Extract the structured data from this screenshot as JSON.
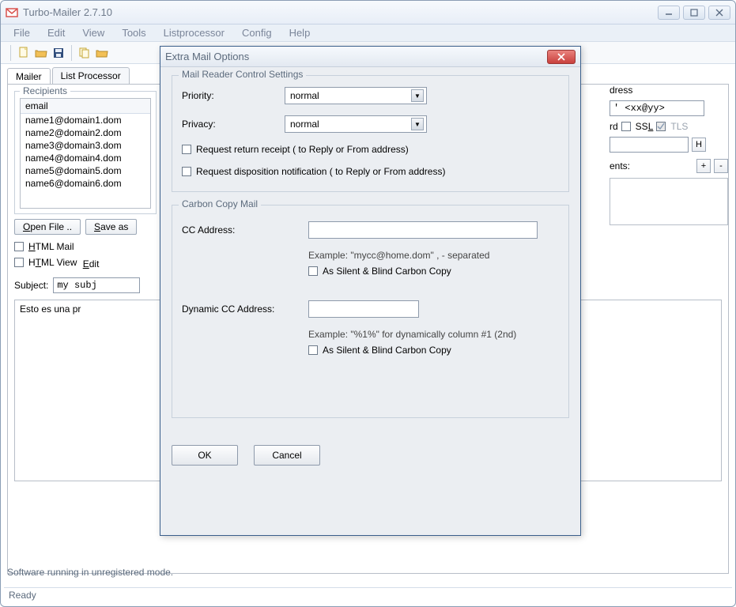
{
  "window": {
    "title": "Turbo-Mailer 2.7.10"
  },
  "menu": {
    "file": "File",
    "edit": "Edit",
    "view": "View",
    "tools": "Tools",
    "listprocessor": "Listprocessor",
    "config": "Config",
    "help": "Help"
  },
  "tabs": {
    "mailer": "Mailer",
    "listprocessor": "List Processor"
  },
  "recipients": {
    "title": "Recipients",
    "header": "email",
    "rows": [
      "name1@domain1.dom",
      "name2@domain2.dom",
      "name3@domain3.dom",
      "name4@domain4.dom",
      "name5@domain5.dom",
      "name6@domain6.dom"
    ]
  },
  "buttons": {
    "open_file": "Open File ..",
    "save_as": "Save as"
  },
  "checks": {
    "html_mail": "HTML Mail",
    "html_view": "HTML View",
    "edit": "Edit"
  },
  "subject": {
    "label": "Subject:",
    "value": "my subj"
  },
  "body": {
    "value": "Esto es una pr"
  },
  "right": {
    "dress_label": "dress",
    "placeholder_text": "' <xx@yy>",
    "rd_label": "rd",
    "ssl_label": "SSL",
    "tls_label": "TLS",
    "h_btn": "H",
    "nts_label": "ents:"
  },
  "status": {
    "unregistered": "Software running in unregistered mode.",
    "ready": "Ready"
  },
  "dialog": {
    "title": "Extra Mail Options",
    "fieldset1": {
      "legend": "Mail Reader Control Settings",
      "priority_label": "Priority:",
      "priority_value": "normal",
      "privacy_label": "Privacy:",
      "privacy_value": "normal",
      "return_receipt": "Request return receipt   ( to Reply or From address)",
      "disposition": "Request disposition notification   ( to Reply or From address)"
    },
    "fieldset2": {
      "legend": "Carbon Copy Mail",
      "cc_label": "CC Address:",
      "cc_example": "Example: \"mycc@home.dom\"     , - separated",
      "cc_silent": "As Silent & Blind Carbon Copy",
      "dyn_label": "Dynamic CC Address:",
      "dyn_example": "Example: \"%1%\" for dynamically column #1 (2nd)",
      "dyn_silent": "As Silent & Blind Carbon Copy"
    },
    "ok": "OK",
    "cancel": "Cancel"
  }
}
